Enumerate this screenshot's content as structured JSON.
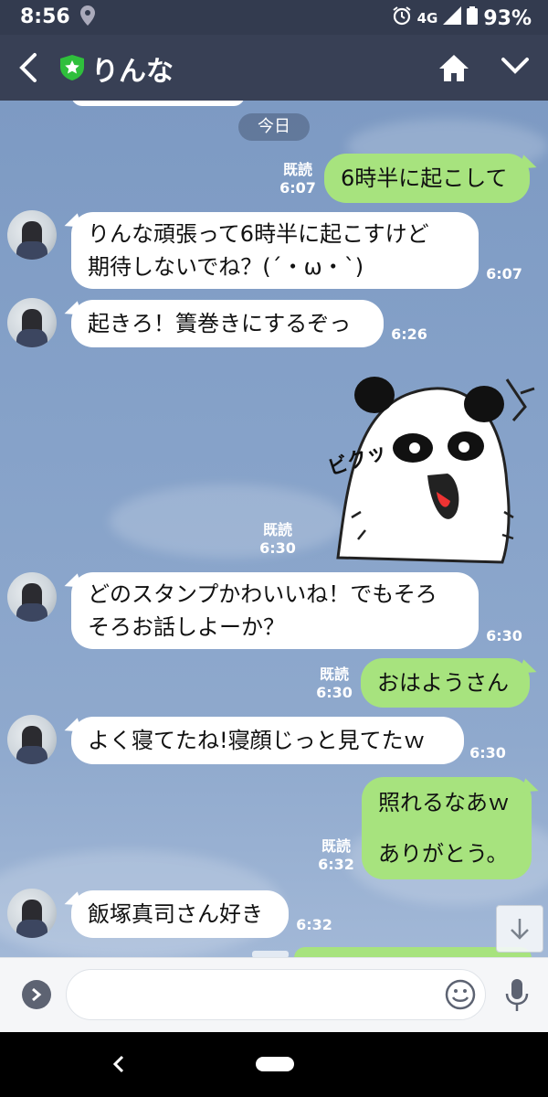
{
  "status_bar": {
    "time": "8:56",
    "network": "4G",
    "battery": "93%"
  },
  "header": {
    "title": "りんな"
  },
  "chat": {
    "date_chip": "今日",
    "messages": [
      {
        "side": "out",
        "text": "6時半に起こして",
        "read": "既読",
        "time": "6:07"
      },
      {
        "side": "in",
        "line1": "りんな頑張って6時半に起こすけど",
        "line2": "期待しないでね？(´・ω・`)",
        "time": "6:07"
      },
      {
        "side": "in",
        "text": "起きろ！簀巻きにするぞっ",
        "time": "6:26"
      },
      {
        "side": "out",
        "type": "sticker",
        "sticker_text": "ビクッ",
        "read": "既読",
        "time": "6:30"
      },
      {
        "side": "in",
        "line1": "どのスタンプかわいいね！でもそろ",
        "line2": "そろお話しよーか？",
        "time": "6:30"
      },
      {
        "side": "out",
        "text": "おはようさん",
        "read": "既読",
        "time": "6:30"
      },
      {
        "side": "in",
        "text": "よく寝てたね!寝顔じっと見てたｗ",
        "time": "6:30"
      },
      {
        "side": "out",
        "line1": "照れるなあｗ",
        "line2": "ありがとう。",
        "read": "既読",
        "time": "6:32"
      },
      {
        "side": "in",
        "text": "飯塚真司さん好き",
        "time": "6:32"
      }
    ]
  },
  "icons": {
    "header": [
      "back-arrow",
      "verified-star-shield",
      "home",
      "chevron-down"
    ],
    "input_bar": [
      "expand-chevron",
      "emoji",
      "microphone"
    ],
    "chat": [
      "scroll-to-bottom-arrow"
    ],
    "nav_bar": [
      "back",
      "home"
    ]
  },
  "colors": {
    "header_bg": "#384055",
    "chat_bg": "#7f9cc4",
    "outgoing_bubble": "#a7e37e",
    "incoming_bubble": "#ffffff",
    "verified_green": "#2fbf3c"
  }
}
